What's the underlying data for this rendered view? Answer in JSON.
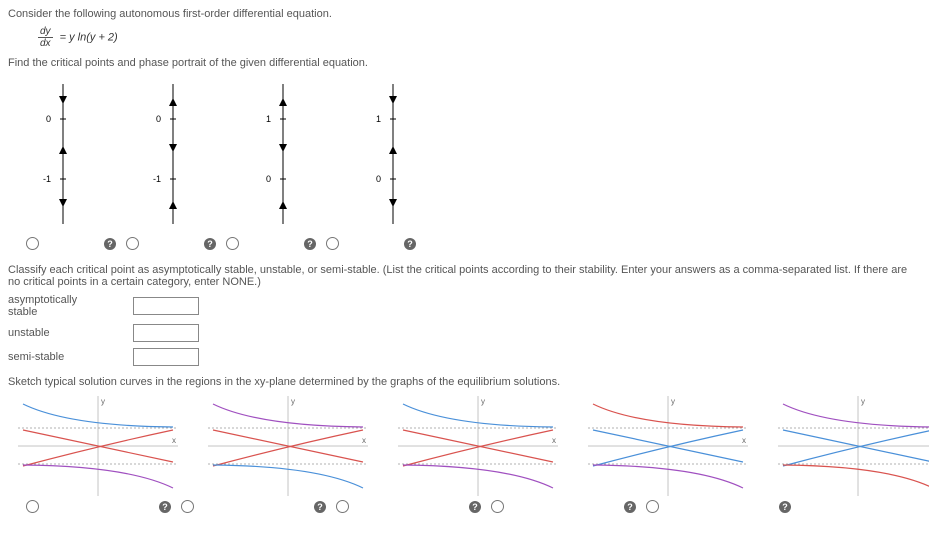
{
  "q1": "Consider the following autonomous first-order differential equation.",
  "eq_num": "dy",
  "eq_den": "dx",
  "eq_rhs": "= y ln(y + 2)",
  "q2": "Find the critical points and phase portrait of the given differential equation.",
  "phase_portraits": [
    {
      "top_label": "0",
      "bottom_label": "-1",
      "top_arrow": "down",
      "mid_arrow": "up",
      "bot_arrow": "down"
    },
    {
      "top_label": "0",
      "bottom_label": "-1",
      "top_arrow": "up",
      "mid_arrow": "down",
      "bot_arrow": "up"
    },
    {
      "top_label": "1",
      "bottom_label": "0",
      "top_arrow": "up",
      "mid_arrow": "down",
      "bot_arrow": "up"
    },
    {
      "top_label": "1",
      "bottom_label": "0",
      "top_arrow": "down",
      "mid_arrow": "up",
      "bot_arrow": "down"
    }
  ],
  "q3": "Classify each critical point as asymptotically stable, unstable, or semi-stable. (List the critical points according to their stability. Enter your answers as a comma-separated list. If there are no critical points in a certain category, enter NONE.)",
  "labels": {
    "asym": "asymptotically stable",
    "unstable": "unstable",
    "semi": "semi-stable"
  },
  "q4": "Sketch typical solution curves in the regions in the xy-plane determined by the graphs of the equilibrium solutions.",
  "axis_x": "x",
  "axis_y": "y",
  "chart_data": {
    "type": "phase_plot",
    "solution_curves_options": 5,
    "equilibrium_lines": [
      1,
      -1
    ],
    "x_range": [
      -4,
      4
    ],
    "y_range": [
      -2,
      2
    ]
  }
}
